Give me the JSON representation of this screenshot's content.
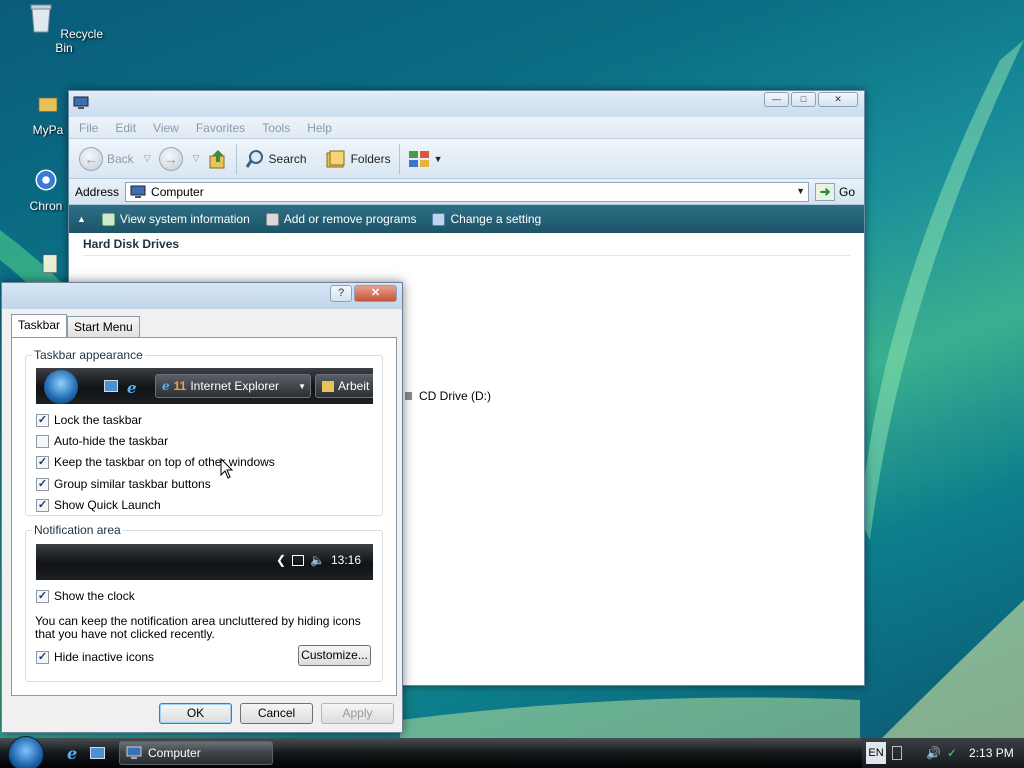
{
  "desktop": {
    "icons": [
      {
        "label": "Recycle Bin",
        "icon": "recycle-bin-icon"
      },
      {
        "label": "MyPa",
        "icon": "folder-icon"
      },
      {
        "label": "Chron",
        "icon": "chrome-icon"
      },
      {
        "label": "",
        "icon": "shortcut-icon"
      }
    ]
  },
  "explorer": {
    "menu": [
      "File",
      "Edit",
      "View",
      "Favorites",
      "Tools",
      "Help"
    ],
    "toolbar": {
      "back_label": "Back",
      "search_label": "Search",
      "folders_label": "Folders"
    },
    "address": {
      "label": "Address",
      "value": "Computer",
      "go_label": "Go"
    },
    "tasks": [
      {
        "label": "View system information",
        "icon": "system-info-icon"
      },
      {
        "label": "Add or remove programs",
        "icon": "programs-icon"
      },
      {
        "label": "Change a setting",
        "icon": "control-panel-icon"
      }
    ],
    "section_title": "Hard Disk Drives",
    "cd_drive_label": "CD Drive (D:)"
  },
  "dialog": {
    "tabs": [
      "Taskbar",
      "Start Menu"
    ],
    "taskbar_appearance": {
      "title": "Taskbar appearance",
      "preview": {
        "ie_label": "Internet Explorer",
        "other_label": "Arbeit"
      },
      "options": [
        {
          "label": "Lock the taskbar",
          "checked": true
        },
        {
          "label": "Auto-hide the taskbar",
          "checked": false
        },
        {
          "label": "Keep the taskbar on top of other windows",
          "checked": true
        },
        {
          "label": "Group similar taskbar buttons",
          "checked": true
        },
        {
          "label": "Show Quick Launch",
          "checked": true
        }
      ]
    },
    "notification_area": {
      "title": "Notification area",
      "preview_time": "13:16",
      "show_clock": {
        "label": "Show the clock",
        "checked": true
      },
      "description": "You can keep the notification area uncluttered by hiding icons that you have not clicked recently.",
      "hide_inactive": {
        "label": "Hide inactive icons",
        "checked": true
      },
      "customize_label": "Customize..."
    },
    "buttons": {
      "ok": "OK",
      "cancel": "Cancel",
      "apply": "Apply"
    },
    "check_glyph": "✓"
  },
  "taskbar": {
    "window_button": "Computer",
    "language": "EN",
    "time": "2:13 PM"
  }
}
